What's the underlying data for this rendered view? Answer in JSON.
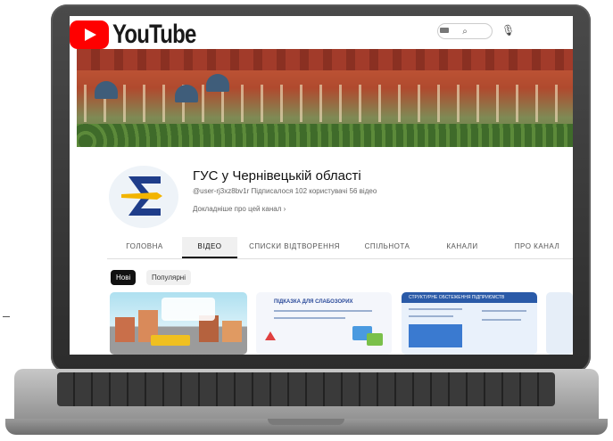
{
  "logo": {
    "wordmark": "YouTube"
  },
  "channel": {
    "title": "ГУС у Чернівецькій області",
    "meta": "@user-rj3xz8bv1r  Підписалося 102 користувачі  56 відео",
    "about": "Докладніше про цей канал  ›"
  },
  "tabs": [
    {
      "label": "ГОЛОВНА"
    },
    {
      "label": "ВІДЕО"
    },
    {
      "label": "СПИСКИ ВІДТВОРЕННЯ"
    },
    {
      "label": "СПІЛЬНОТА"
    },
    {
      "label": "КАНАЛИ"
    },
    {
      "label": "ПРО КАНАЛ"
    }
  ],
  "filters": {
    "new": "Нові",
    "popular": "Популярні"
  },
  "thumbnails": {
    "t2_title": "ПІДКАЗКА ДЛЯ СЛАБОЗОРИХ",
    "t3_title": "СТРУКТУРНЕ ОБСТЕЖЕННЯ ПІДПРИЄМСТВ"
  }
}
